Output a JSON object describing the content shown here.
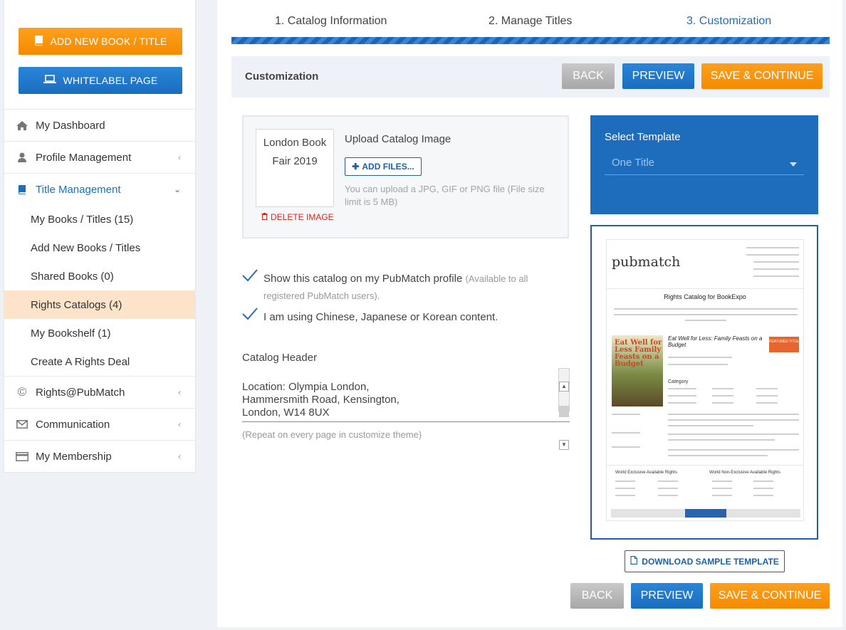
{
  "sidebar": {
    "add_book": "ADD NEW BOOK / TITLE",
    "whitelabel": "WHITELABEL PAGE",
    "nav": [
      {
        "label": "My Dashboard"
      },
      {
        "label": "Profile Management"
      },
      {
        "label": "Title Management"
      },
      {
        "label": "Rights@PubMatch"
      },
      {
        "label": "Communication"
      },
      {
        "label": "My Membership"
      }
    ],
    "sub": [
      {
        "label": "My Books / Titles (15)"
      },
      {
        "label": "Add New Books / Titles"
      },
      {
        "label": "Shared Books (0)"
      },
      {
        "label": "Rights Catalogs (4)"
      },
      {
        "label": "My Bookshelf (1)"
      },
      {
        "label": "Create A Rights Deal"
      }
    ]
  },
  "steps": [
    "1. Catalog Information",
    "2. Manage Titles",
    "3. Customization"
  ],
  "header": {
    "title": "Customization",
    "back": "BACK",
    "preview": "PREVIEW",
    "save": "SAVE & CONTINUE"
  },
  "upload": {
    "thumb_text": "London Book Fair 2019",
    "delete": "DELETE IMAGE",
    "title": "Upload Catalog Image",
    "add_files": "ADD FILES...",
    "hint": "You can upload a JPG, GIF or PNG file (File size limit is 5 MB)"
  },
  "options": {
    "show_catalog": "Show this catalog on my PubMatch profile",
    "show_catalog_note": "(Available to all registered PubMatch users).",
    "cjk": "I am using Chinese, Japanese or Korean content."
  },
  "catalog_header": {
    "label": "Catalog Header",
    "value": "Location: Olympia London,\nHammersmith Road, Kensington,\nLondon, W14 8UX",
    "hint": "(Repeat on every page in customize theme)"
  },
  "template": {
    "label": "Select Template",
    "selected": "One Title"
  },
  "preview_doc": {
    "logo": "pubmatch",
    "title": "Rights Catalog for BookExpo",
    "book_title": "Eat Well for Less: Family Feasts on a Budget",
    "featured": "FEATURED TITLE",
    "cover_text": "Eat Well for Less Family Feasts on a Budget",
    "category": "Category",
    "rights_exclusive": "World Exclusive Available Rights",
    "rights_nonexclusive": "World Non-Exclusive Available Rights"
  },
  "download": "DOWNLOAD SAMPLE TEMPLATE",
  "footer": {
    "back": "BACK",
    "preview": "PREVIEW",
    "save": "SAVE & CONTINUE"
  },
  "colors": {
    "accent_blue": "#1e6dbc",
    "accent_orange": "#f58a00",
    "selected_row": "#fde3c9"
  }
}
